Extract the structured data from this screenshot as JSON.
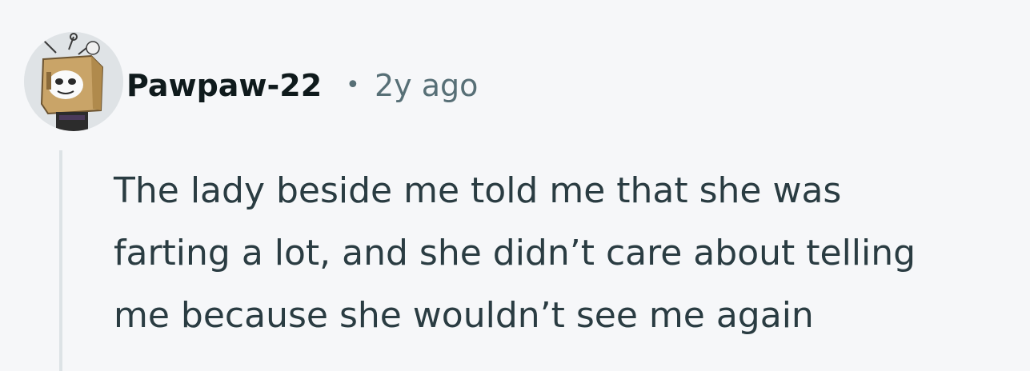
{
  "comment": {
    "username": "Pawpaw-22",
    "separator": "•",
    "timestamp": "2y ago",
    "body_lines": [
      "The lady beside me told me that she was",
      "farting a lot, and she didn’t care about telling",
      "me because she wouldn’t see me again"
    ]
  },
  "colors": {
    "background": "#f6f7f9",
    "username": "#0f1a1c",
    "meta": "#576f76",
    "body_text": "#2a3c42",
    "thread_line": "#dde3e6"
  }
}
